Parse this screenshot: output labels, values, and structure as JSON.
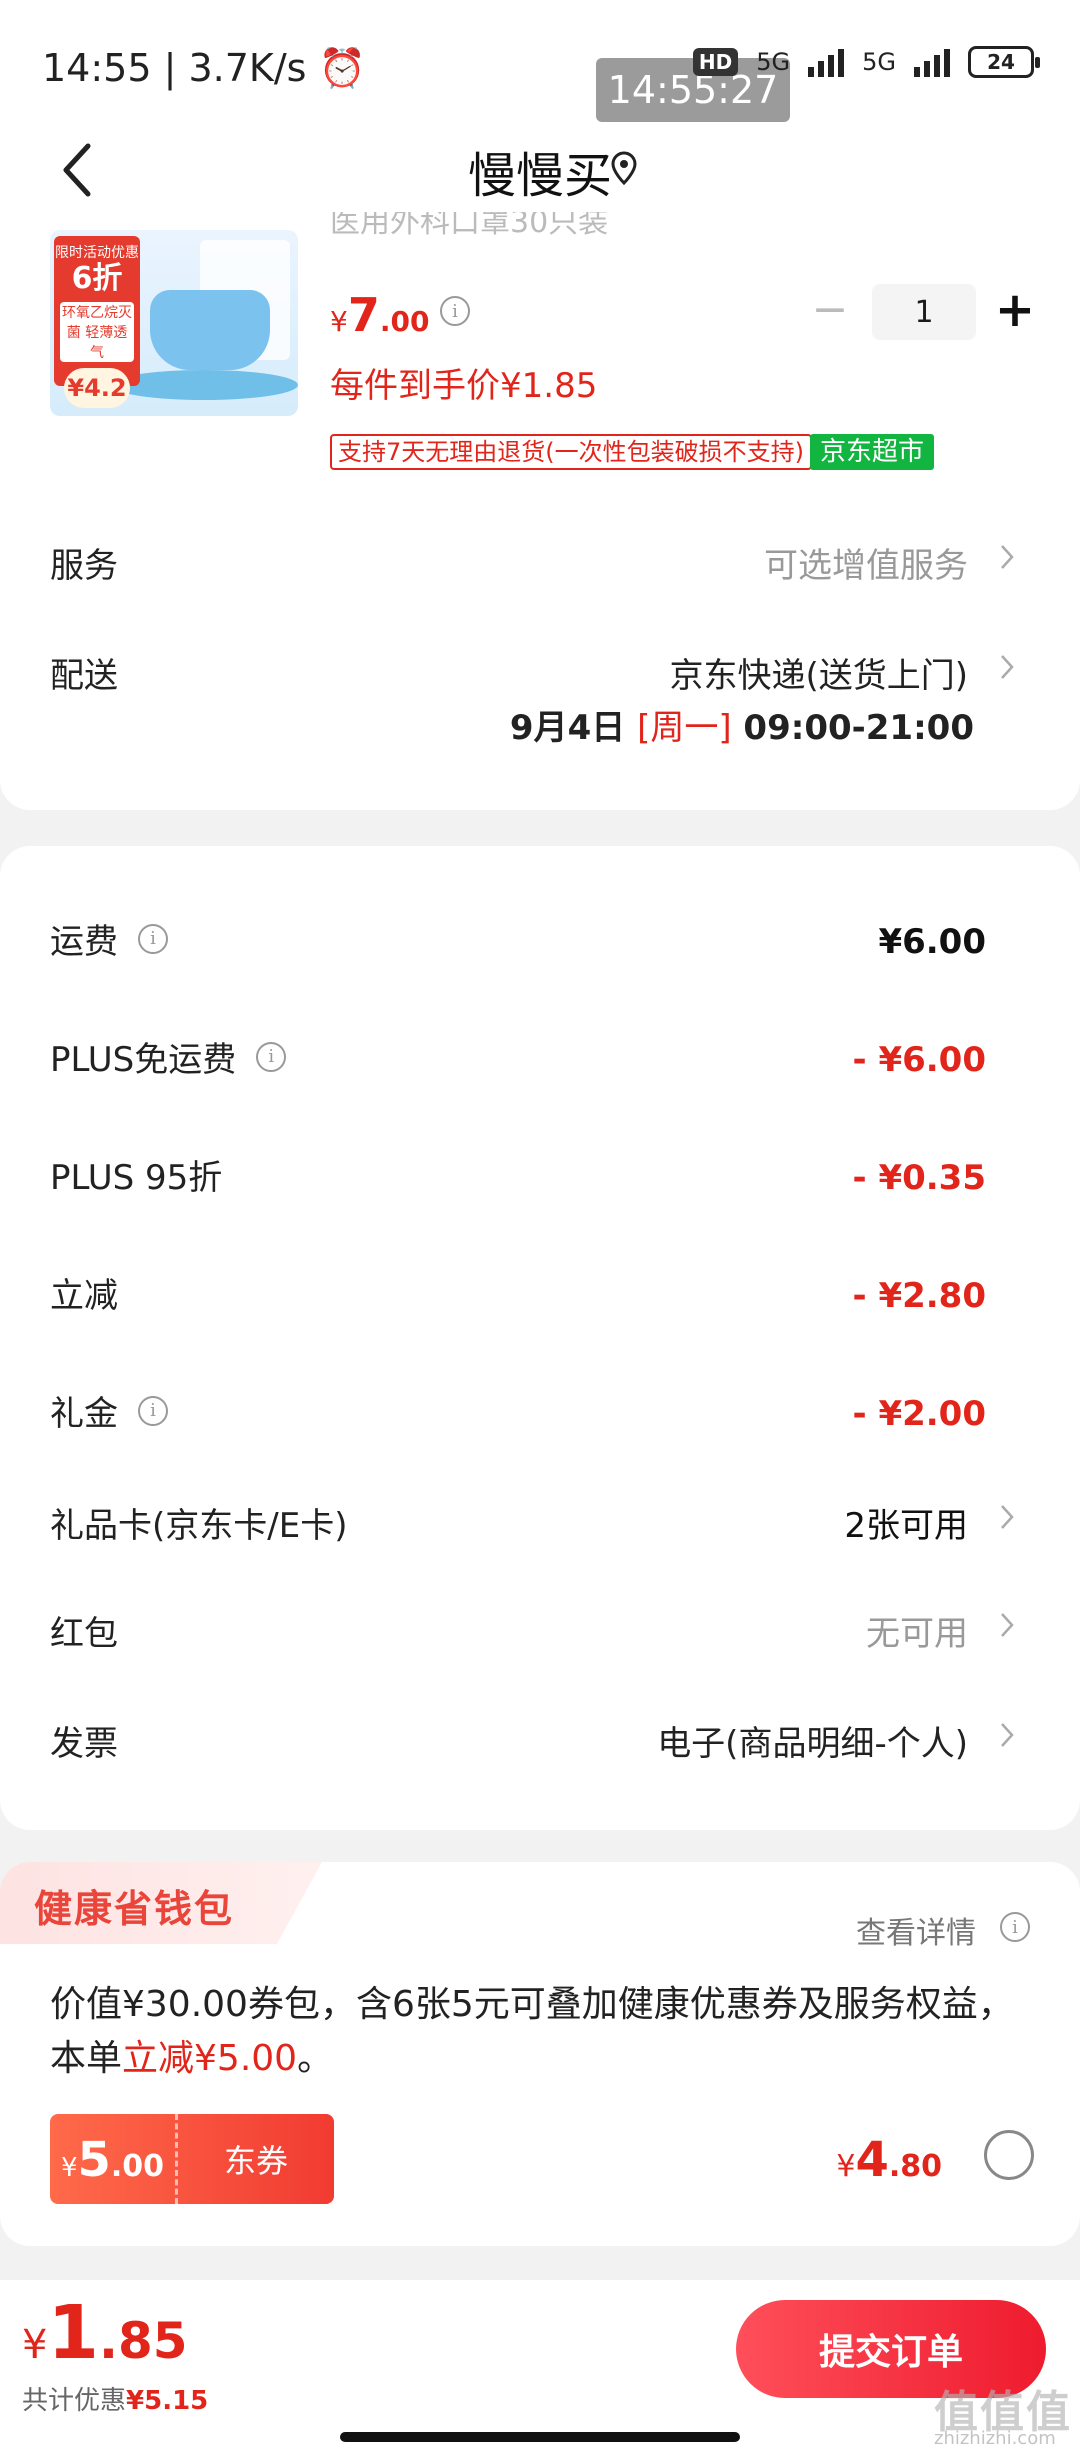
{
  "status_bar": {
    "time": "14:55",
    "speed": "3.7K/s",
    "overlay_time": "14:55:27",
    "hd": "HD",
    "net1": "5G",
    "net2": "5G",
    "battery": "24"
  },
  "header": {
    "title": "慢慢买"
  },
  "product": {
    "name_partial": "医用外科口罩30只装",
    "promo_line1": "限时活动优惠",
    "promo_discount": "6折",
    "promo_line2": "环氧乙烷灭菌 轻薄透气",
    "promo_price": "¥4.2",
    "price_currency": "¥",
    "price_int": "7",
    "price_dec": ".00",
    "quantity": "1",
    "unit_price": "每件到手价¥1.85",
    "return_policy": "支持7天无理由退货(一次性包装破损不支持)",
    "store_tag": "京东超市"
  },
  "service": {
    "label": "服务",
    "value": "可选增值服务"
  },
  "delivery": {
    "label": "配送",
    "value": "京东快递(送货上门)",
    "date": "9月4日 ",
    "weekday": "[周一]",
    "time": " 09:00-21:00"
  },
  "fees": [
    {
      "label": "运费",
      "value": "¥6.00"
    },
    {
      "label": "PLUS免运费",
      "value": "- ¥6.00"
    },
    {
      "label": "PLUS 95折",
      "value": "- ¥0.35"
    },
    {
      "label": "立减",
      "value": "- ¥2.80"
    },
    {
      "label": "礼金",
      "value": "- ¥2.00"
    }
  ],
  "gift_card": {
    "label": "礼品卡(京东卡/E卡)",
    "value": "2张可用"
  },
  "red_packet": {
    "label": "红包",
    "value": "无可用"
  },
  "invoice": {
    "label": "发票",
    "value": "电子(商品明细-个人)"
  },
  "wallet": {
    "title": "健康省钱包",
    "detail": "查看详情",
    "desc_pre": "价值¥30.00券包，含6张5元可叠加健康优惠券及服务权益，本单",
    "desc_red": "立减¥5.00",
    "desc_post": "。",
    "coupon_currency": "¥",
    "coupon_int": "5",
    "coupon_dec": ".00",
    "coupon_name": "东券",
    "price_currency": "¥",
    "price_int": "4",
    "price_dec": ".80"
  },
  "bottom": {
    "total_currency": "¥",
    "total_int": "1",
    "total_dec": ".85",
    "saving_label": "共计优惠",
    "saving_value": "¥5.15",
    "submit": "提交订单"
  },
  "watermark": {
    "main": "值值值",
    "sub": "zhizhizhi.com"
  },
  "colors": {
    "accent_red": "#e1251b",
    "jd_green": "#12b53f"
  }
}
